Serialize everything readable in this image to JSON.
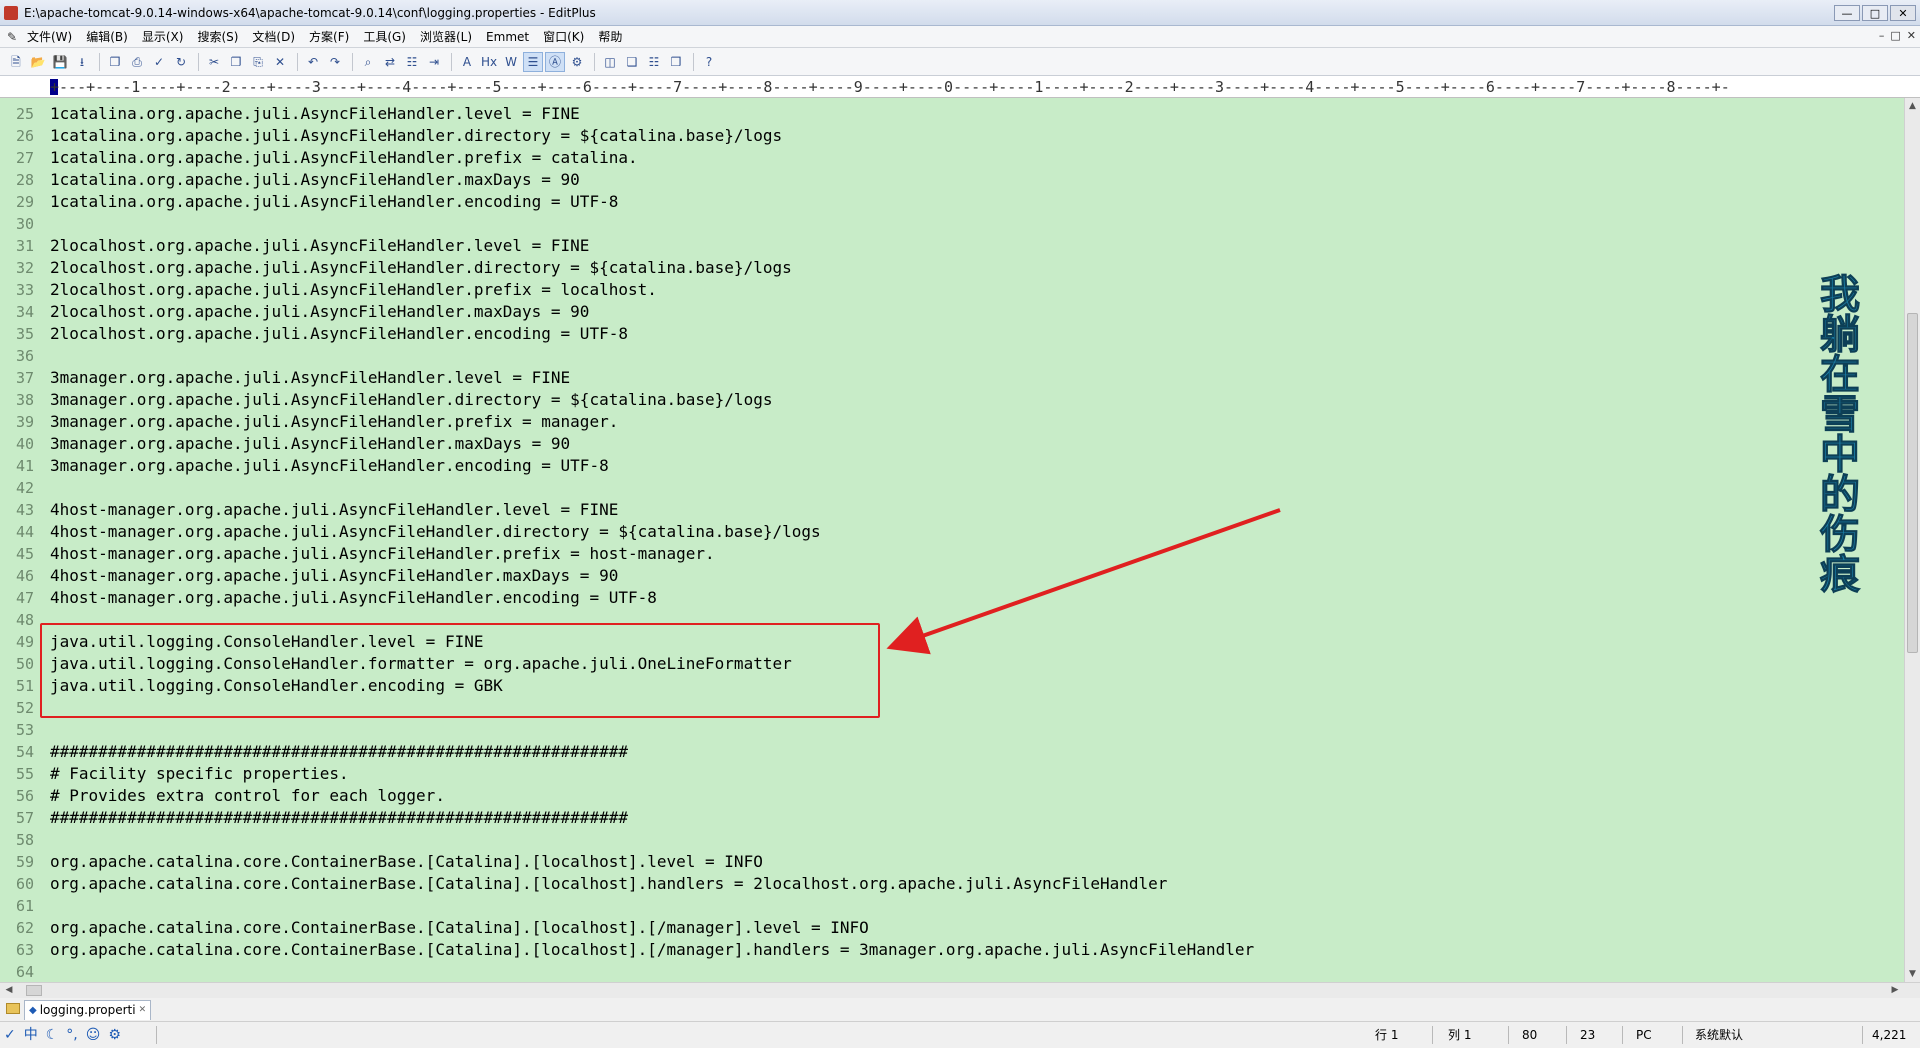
{
  "window": {
    "title": "E:\\apache-tomcat-9.0.14-windows-x64\\apache-tomcat-9.0.14\\conf\\logging.properties - EditPlus",
    "buttons": [
      "—",
      "□",
      "✕"
    ]
  },
  "menu": {
    "items": [
      "文件(W)",
      "编辑(B)",
      "显示(X)",
      "搜索(S)",
      "文档(D)",
      "方案(F)",
      "工具(G)",
      "浏览器(L)",
      "Emmet",
      "窗口(K)",
      "帮助"
    ],
    "mdi_buttons": [
      "–",
      "□",
      "✕"
    ]
  },
  "toolbar": {
    "icons": [
      "new-file-icon",
      "open-folder-icon",
      "save-icon",
      "save-all-icon",
      "|",
      "print-preview-icon",
      "print-icon",
      "spell-check-icon",
      "browser-icon",
      "|",
      "cut-icon",
      "copy-icon",
      "paste-icon",
      "delete-icon",
      "|",
      "undo-icon",
      "redo-icon",
      "|",
      "find-icon",
      "replace-icon",
      "find-in-files-icon",
      "goto-line-icon",
      "|",
      "font-icon",
      "hex-icon",
      "word-wrap-icon",
      "line-number-icon",
      "ruler-icon",
      "settings-icon",
      "|",
      "window-tile-icon",
      "window-cascade-icon",
      "window-list-icon",
      "window-arrange-icon",
      "|",
      "help-icon"
    ],
    "glyphs": {
      "new-file-icon": "🗎",
      "open-folder-icon": "📂",
      "save-icon": "💾",
      "save-all-icon": "⭳",
      "print-preview-icon": "❐",
      "print-icon": "⎙",
      "spell-check-icon": "✓",
      "browser-icon": "↻",
      "cut-icon": "✂",
      "copy-icon": "❐",
      "paste-icon": "⎘",
      "delete-icon": "✕",
      "undo-icon": "↶",
      "redo-icon": "↷",
      "find-icon": "⌕",
      "replace-icon": "⇄",
      "find-in-files-icon": "☷",
      "goto-line-icon": "⇥",
      "font-icon": "A",
      "hex-icon": "Hx",
      "word-wrap-icon": "W",
      "line-number-icon": "☰",
      "ruler-icon": "Ⓐ",
      "settings-icon": "⚙",
      "window-tile-icon": "◫",
      "window-cascade-icon": "❑",
      "window-list-icon": "☷",
      "window-arrange-icon": "❒",
      "help-icon": "?"
    }
  },
  "ruler": {
    "text": "+---+----1----+----2----+----3----+----4----+----5----+----6----+----7----+----8----+----9----+----0----+----1----+----2----+----3----+----4----+----5----+----6----+----7----+----8----+-"
  },
  "editor": {
    "lines": [
      {
        "n": "25",
        "t": "1catalina.org.apache.juli.AsyncFileHandler.level = FINE"
      },
      {
        "n": "26",
        "t": "1catalina.org.apache.juli.AsyncFileHandler.directory = ${catalina.base}/logs"
      },
      {
        "n": "27",
        "t": "1catalina.org.apache.juli.AsyncFileHandler.prefix = catalina."
      },
      {
        "n": "28",
        "t": "1catalina.org.apache.juli.AsyncFileHandler.maxDays = 90"
      },
      {
        "n": "29",
        "t": "1catalina.org.apache.juli.AsyncFileHandler.encoding = UTF-8"
      },
      {
        "n": "30",
        "t": ""
      },
      {
        "n": "31",
        "t": "2localhost.org.apache.juli.AsyncFileHandler.level = FINE"
      },
      {
        "n": "32",
        "t": "2localhost.org.apache.juli.AsyncFileHandler.directory = ${catalina.base}/logs"
      },
      {
        "n": "33",
        "t": "2localhost.org.apache.juli.AsyncFileHandler.prefix = localhost."
      },
      {
        "n": "34",
        "t": "2localhost.org.apache.juli.AsyncFileHandler.maxDays = 90"
      },
      {
        "n": "35",
        "t": "2localhost.org.apache.juli.AsyncFileHandler.encoding = UTF-8"
      },
      {
        "n": "36",
        "t": ""
      },
      {
        "n": "37",
        "t": "3manager.org.apache.juli.AsyncFileHandler.level = FINE"
      },
      {
        "n": "38",
        "t": "3manager.org.apache.juli.AsyncFileHandler.directory = ${catalina.base}/logs"
      },
      {
        "n": "39",
        "t": "3manager.org.apache.juli.AsyncFileHandler.prefix = manager."
      },
      {
        "n": "40",
        "t": "3manager.org.apache.juli.AsyncFileHandler.maxDays = 90"
      },
      {
        "n": "41",
        "t": "3manager.org.apache.juli.AsyncFileHandler.encoding = UTF-8"
      },
      {
        "n": "42",
        "t": ""
      },
      {
        "n": "43",
        "t": "4host-manager.org.apache.juli.AsyncFileHandler.level = FINE"
      },
      {
        "n": "44",
        "t": "4host-manager.org.apache.juli.AsyncFileHandler.directory = ${catalina.base}/logs"
      },
      {
        "n": "45",
        "t": "4host-manager.org.apache.juli.AsyncFileHandler.prefix = host-manager."
      },
      {
        "n": "46",
        "t": "4host-manager.org.apache.juli.AsyncFileHandler.maxDays = 90"
      },
      {
        "n": "47",
        "t": "4host-manager.org.apache.juli.AsyncFileHandler.encoding = UTF-8"
      },
      {
        "n": "48",
        "t": ""
      },
      {
        "n": "49",
        "t": "java.util.logging.ConsoleHandler.level = FINE"
      },
      {
        "n": "50",
        "t": "java.util.logging.ConsoleHandler.formatter = org.apache.juli.OneLineFormatter"
      },
      {
        "n": "51",
        "t": "java.util.logging.ConsoleHandler.encoding = GBK"
      },
      {
        "n": "52",
        "t": ""
      },
      {
        "n": "53",
        "t": ""
      },
      {
        "n": "54",
        "t": "############################################################"
      },
      {
        "n": "55",
        "t": "# Facility specific properties."
      },
      {
        "n": "56",
        "t": "# Provides extra control for each logger."
      },
      {
        "n": "57",
        "t": "############################################################"
      },
      {
        "n": "58",
        "t": ""
      },
      {
        "n": "59",
        "t": "org.apache.catalina.core.ContainerBase.[Catalina].[localhost].level = INFO"
      },
      {
        "n": "60",
        "t": "org.apache.catalina.core.ContainerBase.[Catalina].[localhost].handlers = 2localhost.org.apache.juli.AsyncFileHandler"
      },
      {
        "n": "61",
        "t": ""
      },
      {
        "n": "62",
        "t": "org.apache.catalina.core.ContainerBase.[Catalina].[localhost].[/manager].level = INFO"
      },
      {
        "n": "63",
        "t": "org.apache.catalina.core.ContainerBase.[Catalina].[localhost].[/manager].handlers = 3manager.org.apache.juli.AsyncFileHandler"
      },
      {
        "n": "64",
        "t": ""
      }
    ]
  },
  "annotation": {
    "watermark": "我躺在雪中的伤痕",
    "highlight_color": "#e02020"
  },
  "tabs": {
    "file_tab": "logging.properti"
  },
  "status": {
    "ime_icons": [
      "✓",
      "中",
      "☾",
      "°,",
      "☺",
      "⚙"
    ],
    "line": "行 1",
    "col": "列 1",
    "width": "80",
    "num": "23",
    "mode": "PC",
    "encoding": "系统默认",
    "size": "4,221"
  },
  "colors": {
    "editor_bg": "#c8ecc8",
    "line_number": "#6e8a6e",
    "watermark": "#1b7fa8"
  }
}
